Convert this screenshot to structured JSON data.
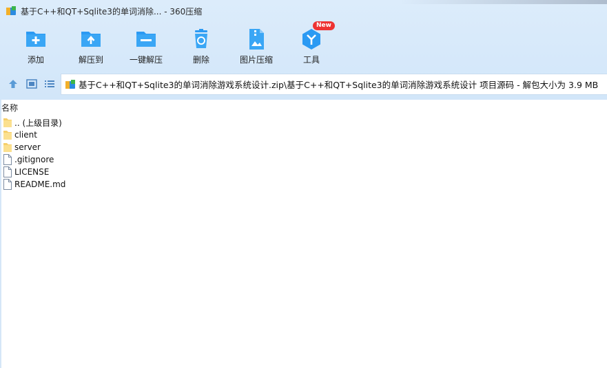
{
  "window": {
    "title": "基于C++和QT+Sqlite3的单词消除... - 360压缩"
  },
  "toolbar": {
    "items": [
      {
        "label": "添加",
        "icon": "add-folder-icon"
      },
      {
        "label": "解压到",
        "icon": "extract-to-icon"
      },
      {
        "label": "一键解压",
        "icon": "one-click-extract-icon"
      },
      {
        "label": "删除",
        "icon": "delete-icon"
      },
      {
        "label": "图片压缩",
        "icon": "image-compress-icon"
      },
      {
        "label": "工具",
        "icon": "tools-icon",
        "badge": "New"
      }
    ]
  },
  "nav": {
    "path": "基于C++和QT+Sqlite3的单词消除游戏系统设计.zip\\基于C++和QT+Sqlite3的单词消除游戏系统设计 项目源码 - 解包大小为 3.9 MB"
  },
  "list": {
    "column_name": "名称",
    "items": [
      {
        "name": ".. (上级目录)",
        "type": "folder"
      },
      {
        "name": "client",
        "type": "folder"
      },
      {
        "name": "server",
        "type": "folder"
      },
      {
        "name": ".gitignore",
        "type": "file"
      },
      {
        "name": "LICENSE",
        "type": "file"
      },
      {
        "name": "README.md",
        "type": "file"
      }
    ]
  },
  "colors": {
    "accent": "#2b9af3",
    "toolbar_bg": "#d6e8fa",
    "badge": "#e53333"
  }
}
